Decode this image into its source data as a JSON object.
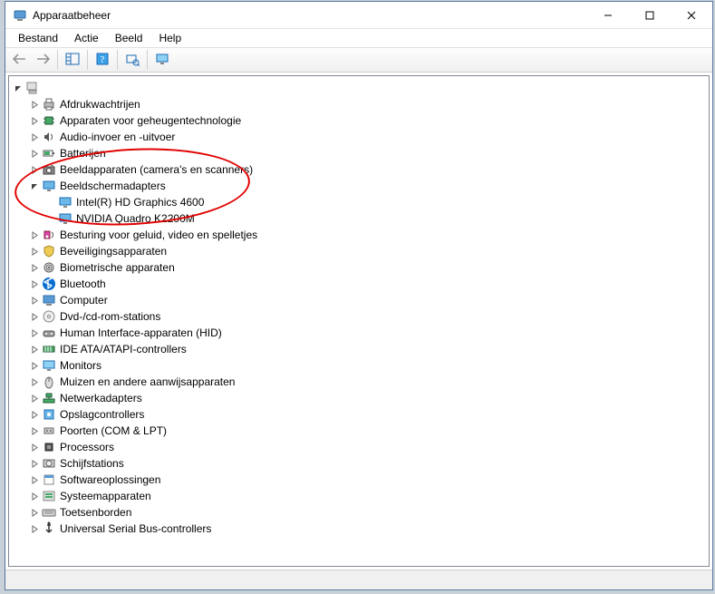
{
  "window": {
    "title": "Apparaatbeheer"
  },
  "menu": {
    "file": "Bestand",
    "action": "Actie",
    "view": "Beeld",
    "help": "Help"
  },
  "tree": {
    "root": "",
    "items": [
      {
        "label": "Afdrukwachtrijen",
        "icon": "printer"
      },
      {
        "label": "Apparaten voor geheugentechnologie",
        "icon": "chip"
      },
      {
        "label": "Audio-invoer en -uitvoer",
        "icon": "speaker"
      },
      {
        "label": "Batterijen",
        "icon": "battery"
      },
      {
        "label": "Beeldapparaten (camera's en scanners)",
        "icon": "camera"
      },
      {
        "label": "Beeldschermadapters",
        "icon": "display",
        "expanded": true,
        "children": [
          {
            "label": "Intel(R) HD Graphics 4600",
            "icon": "display"
          },
          {
            "label": "NVIDIA Quadro K2200M",
            "icon": "display"
          }
        ]
      },
      {
        "label": "Besturing voor geluid, video en spelletjes",
        "icon": "sound"
      },
      {
        "label": "Beveiligingsapparaten",
        "icon": "security"
      },
      {
        "label": "Biometrische apparaten",
        "icon": "fingerprint"
      },
      {
        "label": "Bluetooth",
        "icon": "bluetooth"
      },
      {
        "label": "Computer",
        "icon": "computer"
      },
      {
        "label": "Dvd-/cd-rom-stations",
        "icon": "disc"
      },
      {
        "label": "Human Interface-apparaten (HID)",
        "icon": "hid"
      },
      {
        "label": "IDE ATA/ATAPI-controllers",
        "icon": "ide"
      },
      {
        "label": "Monitors",
        "icon": "monitor"
      },
      {
        "label": "Muizen en andere aanwijsapparaten",
        "icon": "mouse"
      },
      {
        "label": "Netwerkadapters",
        "icon": "network"
      },
      {
        "label": "Opslagcontrollers",
        "icon": "storage"
      },
      {
        "label": "Poorten (COM & LPT)",
        "icon": "port"
      },
      {
        "label": "Processors",
        "icon": "cpu"
      },
      {
        "label": "Schijfstations",
        "icon": "disk"
      },
      {
        "label": "Softwareoplossingen",
        "icon": "software"
      },
      {
        "label": "Systeemapparaten",
        "icon": "system"
      },
      {
        "label": "Toetsenborden",
        "icon": "keyboard"
      },
      {
        "label": "Universal Serial Bus-controllers",
        "icon": "usb"
      }
    ]
  }
}
